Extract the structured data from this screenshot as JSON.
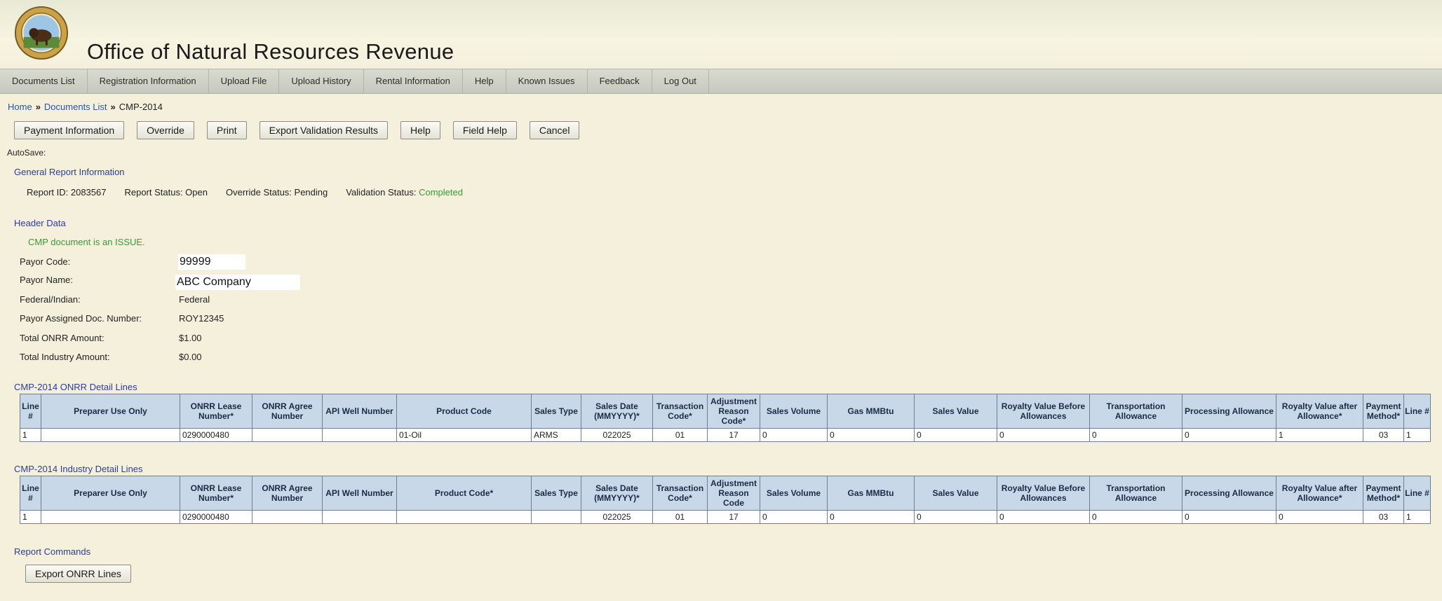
{
  "header": {
    "title": "Office of Natural Resources Revenue"
  },
  "nav": [
    "Documents List",
    "Registration Information",
    "Upload File",
    "Upload History",
    "Rental Information",
    "Help",
    "Known Issues",
    "Feedback",
    "Log Out"
  ],
  "breadcrumb": {
    "home": "Home",
    "documents_list": "Documents List",
    "current": "CMP-2014",
    "separator": "»"
  },
  "toolbar": {
    "payment_information": "Payment Information",
    "override": "Override",
    "print": "Print",
    "export_validation": "Export Validation Results",
    "help": "Help",
    "field_help": "Field Help",
    "cancel": "Cancel"
  },
  "autosave_label": "AutoSave:",
  "general": {
    "title": "General Report Information",
    "report_id": "Report ID:  2083567",
    "report_status": "Report Status:  Open",
    "override_status": "Override Status:  Pending",
    "validation_label": "Validation Status:",
    "validation_value": "Completed"
  },
  "header_data": {
    "title": "Header Data",
    "message": "CMP document is an ISSUE.",
    "payor_code_label": "Payor Code:",
    "payor_code": "99999",
    "payor_name_label": "Payor Name:",
    "payor_name": "ABC Company",
    "federal_indian_label": "Federal/Indian:",
    "federal_indian": "Federal",
    "doc_number_label": "Payor Assigned Doc. Number:",
    "doc_number": "ROY12345",
    "total_onrr_label": "Total ONRR Amount:",
    "total_onrr": "$1.00",
    "total_industry_label": "Total Industry Amount:",
    "total_industry": "$0.00"
  },
  "onrr_table": {
    "title": "CMP-2014 ONRR Detail Lines",
    "columns": [
      "Line #",
      "Preparer Use Only",
      "ONRR Lease Number*",
      "ONRR Agree Number",
      "API Well Number",
      "Product Code",
      "Sales Type",
      "Sales Date (MMYYYY)*",
      "Transaction Code*",
      "Adjustment Reason Code*",
      "Sales Volume",
      "Gas MMBtu",
      "Sales Value",
      "Royalty Value Before Allowances",
      "Transportation Allowance",
      "Processing Allowance",
      "Royalty Value after Allowance*",
      "Payment Method*",
      "Line #"
    ],
    "rows": [
      [
        "1",
        "",
        "0290000480",
        "",
        "",
        "01-Oil",
        "ARMS",
        "022025",
        "01",
        "17",
        "0",
        "0",
        "0",
        "0",
        "0",
        "0",
        "1",
        "03",
        "1"
      ]
    ]
  },
  "industry_table": {
    "title": "CMP-2014 Industry Detail Lines",
    "columns": [
      "Line #",
      "Preparer Use Only",
      "ONRR Lease Number*",
      "ONRR Agree Number",
      "API Well Number",
      "Product Code*",
      "Sales Type",
      "Sales Date (MMYYYY)*",
      "Transaction Code*",
      "Adjustment Reason Code",
      "Sales Volume",
      "Gas MMBtu",
      "Sales Value",
      "Royalty Value Before Allowances",
      "Transportation Allowance",
      "Processing Allowance",
      "Royalty Value after Allowance*",
      "Payment Method*",
      "Line #"
    ],
    "rows": [
      [
        "1",
        "",
        "0290000480",
        "",
        "",
        "",
        "",
        "022025",
        "01",
        "17",
        "0",
        "0",
        "0",
        "0",
        "0",
        "0",
        "0",
        "03",
        "1"
      ]
    ]
  },
  "report_commands": {
    "title": "Report Commands",
    "export_onrr": "Export ONRR Lines"
  }
}
